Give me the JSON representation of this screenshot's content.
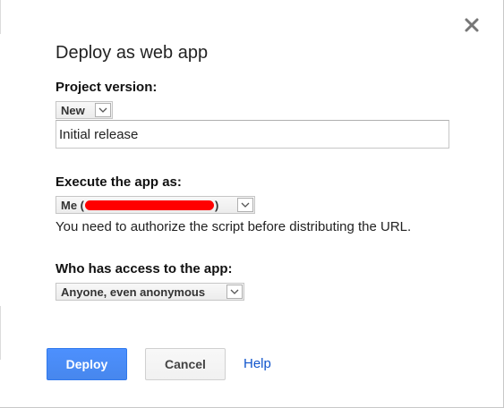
{
  "dialog": {
    "title": "Deploy as web app",
    "close_icon": "close-icon"
  },
  "project_version": {
    "label": "Project version:",
    "selected": "New",
    "description_value": "Initial release"
  },
  "execute_as": {
    "label": "Execute the app as:",
    "selected_prefix": "Me (",
    "selected_suffix": ")",
    "helper_text": "You need to authorize the script before distributing the URL."
  },
  "access": {
    "label": "Who has access to the app:",
    "selected": "Anyone, even anonymous"
  },
  "buttons": {
    "deploy": "Deploy",
    "cancel": "Cancel",
    "help": "Help"
  },
  "colors": {
    "primary_button": "#4d90fe",
    "link": "#1155cc",
    "redaction": "#ff0000"
  }
}
